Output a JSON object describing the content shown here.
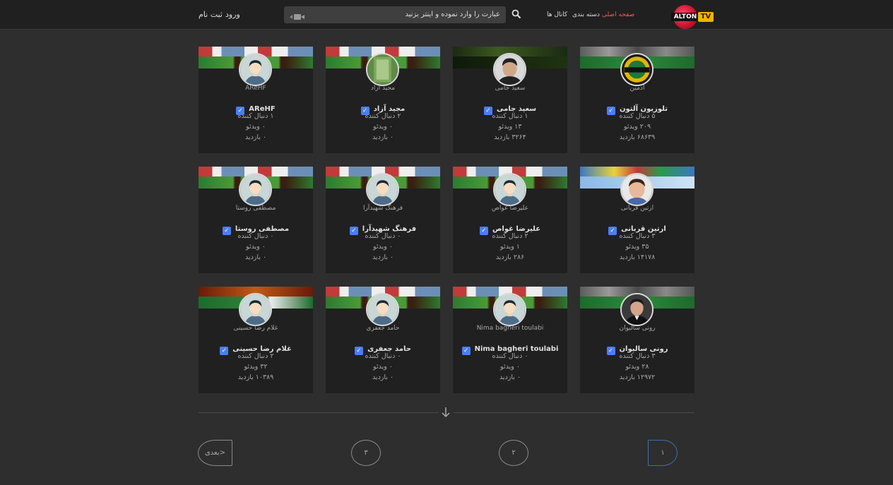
{
  "header": {
    "logo_text": "ALTON",
    "logo_tv": "TV",
    "nav": {
      "home": "صفحه اصلی",
      "categories": "دسته بندی",
      "channels": "کانال ها"
    },
    "search_placeholder": "عبارت را وارد نموده و اینتر بزنید",
    "login": "ورود",
    "register": "ثبت نام"
  },
  "colors": {
    "accent": "#ff5555",
    "verified": "#4a7ef5",
    "card_bg": "#202020",
    "page_bg": "#2e2e2e"
  },
  "channels": [
    {
      "username": "ادمین",
      "name": "تلوزیون آلتون",
      "followers": "۵ دنبال کننده",
      "videos": "۲۰۹ ویدئو",
      "views": "۶۸۶۳۹ بازدید",
      "avatar": "alton-logo",
      "banner": "snooker"
    },
    {
      "username": "سعید جامی",
      "name": "سعید جامی",
      "followers": "۱ دنبال کننده",
      "videos": "۱۳ ویدئو",
      "views": "۳۲۶۴ بازدید",
      "avatar": "photo",
      "banner": "green"
    },
    {
      "username": "مجید آزاد",
      "name": "مجید آزاد",
      "followers": "۲ دنبال کننده",
      "videos": "۰ ویدئو",
      "views": "۰ بازدید",
      "avatar": "green-photo",
      "banner": "horses"
    },
    {
      "username": "AReHF",
      "name": "AReHF",
      "followers": "۱ دنبال کننده",
      "videos": "۰ ویدئو",
      "views": "۰ بازدید",
      "avatar": "default",
      "banner": "horses"
    },
    {
      "username": "ارتین قربانی",
      "name": "ارتین قربانی",
      "followers": "۳ دنبال کننده",
      "videos": "۳۵ ویدئو",
      "views": "۱۴۱۷۸ بازدید",
      "avatar": "kid-photo",
      "banner": "balls"
    },
    {
      "username": "علیرضا غواص",
      "name": "علیرضا غواص",
      "followers": "۲ دنبال کننده",
      "videos": "۱ ویدئو",
      "views": "۲۸۶ بازدید",
      "avatar": "default",
      "banner": "horses"
    },
    {
      "username": "فرهنگ شهیدآرا",
      "name": "فرهنگ شهیدآرا",
      "followers": "۰ دنبال کننده",
      "videos": "۰ ویدئو",
      "views": "۰ بازدید",
      "avatar": "default",
      "banner": "horses"
    },
    {
      "username": "مصطفی روستا",
      "name": "مصطفی روستا",
      "followers": "۰ دنبال کننده",
      "videos": "۰ ویدئو",
      "views": "۰ بازدید",
      "avatar": "default",
      "banner": "horses"
    },
    {
      "username": "رونی سالیوان",
      "name": "رونی سالیوان",
      "followers": "۳ دنبال کننده",
      "videos": "۲۸ ویدئو",
      "views": "۱۲۹۷۲ بازدید",
      "avatar": "man-photo",
      "banner": "snooker"
    },
    {
      "username": "Nima bagheri toulabi",
      "name": "Nima bagheri toulabi",
      "followers": "۰ دنبال کننده",
      "videos": "۰ ویدئو",
      "views": "۰ بازدید",
      "avatar": "default",
      "banner": "horses"
    },
    {
      "username": "حامد جعفری",
      "name": "حامد جعفری",
      "followers": "۰ دنبال کننده",
      "videos": "۰ ویدئو",
      "views": "۰ بازدید",
      "avatar": "default",
      "banner": "horses"
    },
    {
      "username": "غلام رضا حسینی",
      "name": "غلام رضا حسینی",
      "followers": "۲ دنبال کننده",
      "videos": "۳۲ ویدئو",
      "views": "۱۰۳۸۹ بازدید",
      "avatar": "default",
      "banner": "table"
    }
  ],
  "pagination": {
    "page1": "۱",
    "page2": "۲",
    "page3": "۳",
    "next": "بعدی>"
  }
}
